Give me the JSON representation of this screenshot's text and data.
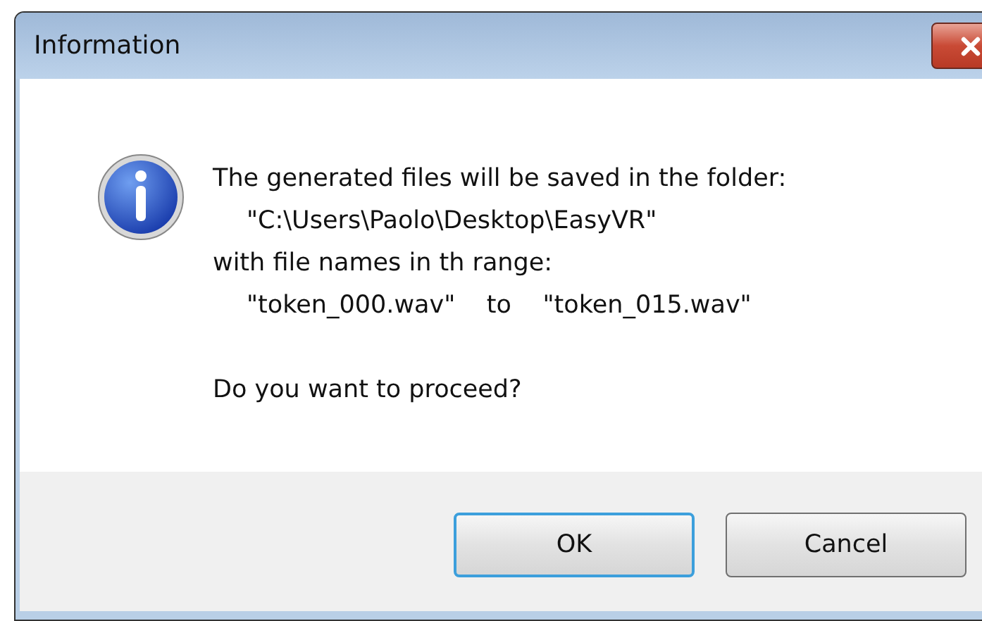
{
  "window": {
    "title": "Information"
  },
  "message": {
    "lines": [
      {
        "text": "The generated files will be saved in the folder:",
        "kind": "plain"
      },
      {
        "text": "\"C:\\Users\\Paolo\\Desktop\\EasyVR\"",
        "kind": "indented"
      },
      {
        "text": "with file names in th range:",
        "kind": "plain"
      },
      {
        "text": "\"token_000.wav\"    to    \"token_015.wav\"",
        "kind": "indented"
      }
    ],
    "question": "Do you want to proceed?"
  },
  "buttons": [
    {
      "label": "OK",
      "default": true
    },
    {
      "label": "Cancel",
      "default": false
    }
  ]
}
